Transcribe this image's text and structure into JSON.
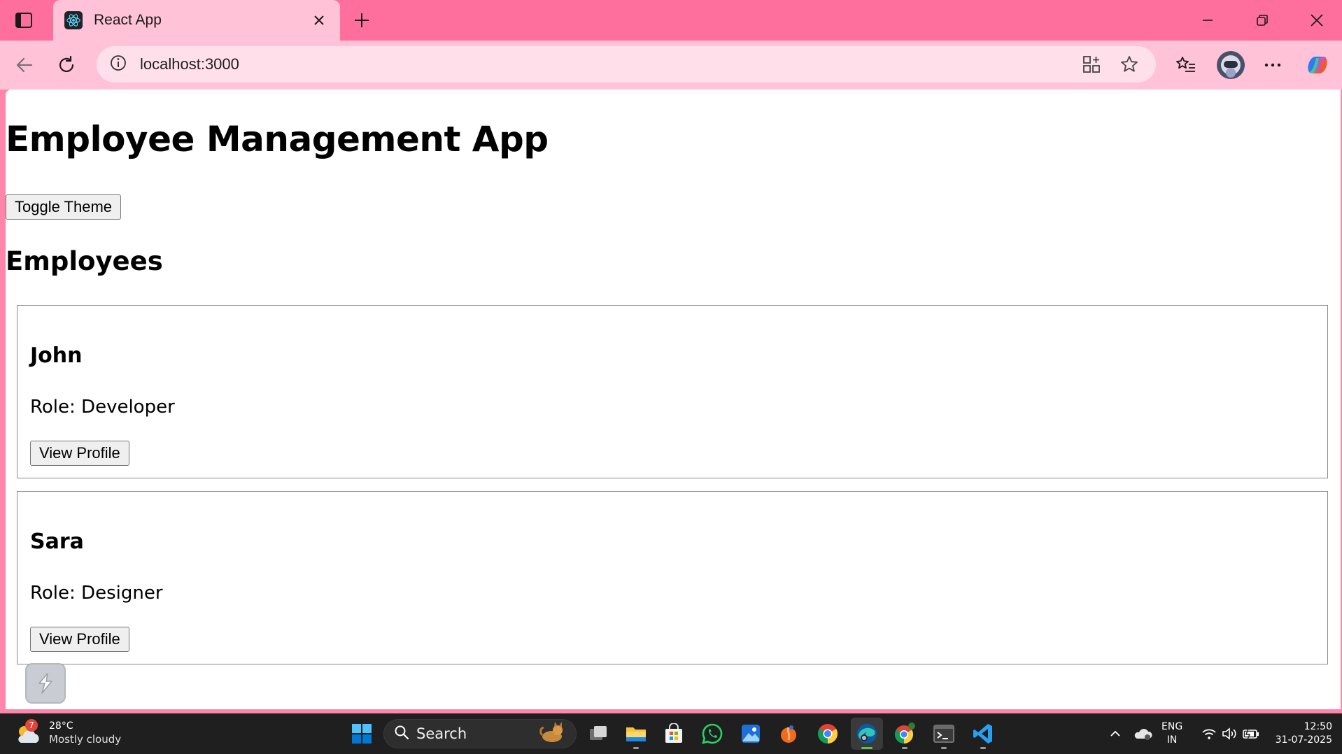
{
  "browser": {
    "tab_title": "React App",
    "url": "localhost:3000"
  },
  "page": {
    "title": "Employee Management App",
    "toggle_theme_label": "Toggle Theme",
    "section_title": "Employees",
    "employees": [
      {
        "name": "John",
        "role": "Role: Developer",
        "button": "View Profile"
      },
      {
        "name": "Sara",
        "role": "Role: Designer",
        "button": "View Profile"
      }
    ]
  },
  "taskbar": {
    "weather": {
      "badge": "7",
      "temp": "28°C",
      "condition": "Mostly cloudy"
    },
    "search_label": "Search",
    "lang_line1": "ENG",
    "lang_line2": "IN",
    "time": "12:50",
    "date": "31-07-2025"
  },
  "colors": {
    "titlebar": "#ff6f9e",
    "toolbar": "#ffc2d6",
    "omnibox": "#ffe0ea",
    "taskbar": "#1f1f1f",
    "react_logo": "#61dafb"
  }
}
